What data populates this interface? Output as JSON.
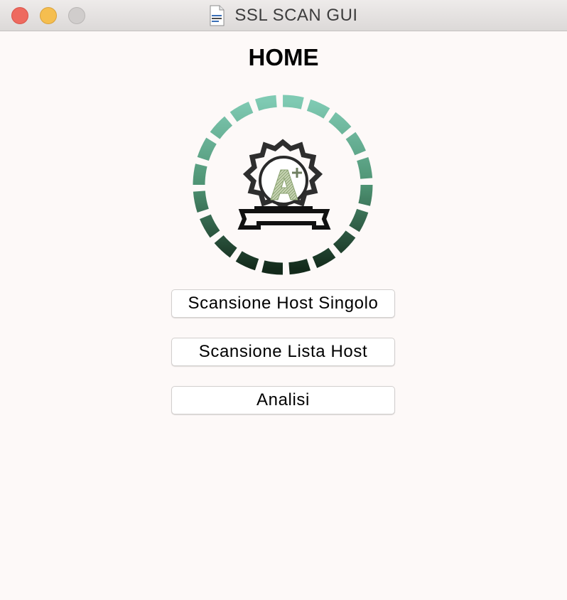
{
  "window": {
    "title": "SSL SCAN GUI"
  },
  "page": {
    "heading": "HOME"
  },
  "buttons": {
    "single_host": "Scansione Host Singolo",
    "host_list": "Scansione Lista Host",
    "analysis": "Analisi"
  },
  "icons": {
    "window_icon": "document-icon",
    "logo": "ssl-grade-a-plus-badge-icon"
  },
  "colors": {
    "close": "#ee6a5f",
    "minimize": "#f5be4f",
    "zoom": "#d0cdcc",
    "ring_top": "#7fcab3",
    "ring_bottom": "#132a1b",
    "background": "#fdf9f8"
  }
}
